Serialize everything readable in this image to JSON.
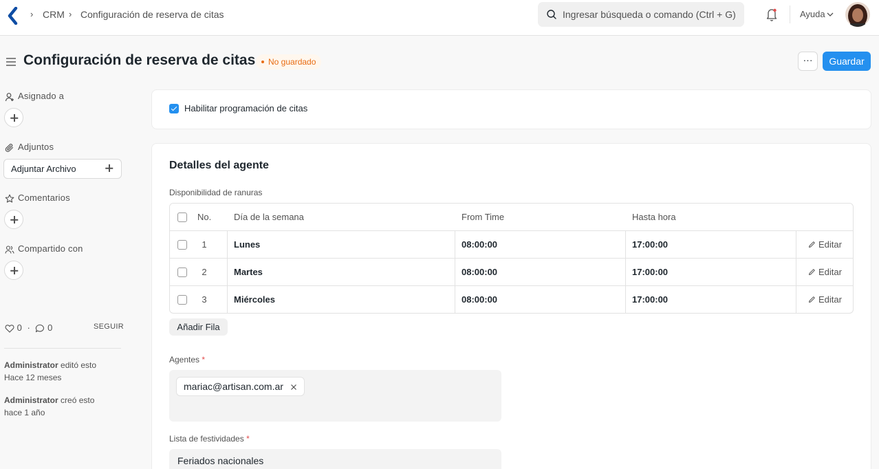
{
  "navbar": {
    "breadcrumbs": [
      "CRM",
      "Configuración de reserva de citas"
    ],
    "search_placeholder": "Ingresar búsqueda o comando (Ctrl + G)",
    "help_label": "Ayuda"
  },
  "header": {
    "title": "Configuración de reserva de citas",
    "status": "No guardado",
    "more_label": "···",
    "save_label": "Guardar"
  },
  "sidebar": {
    "assigned_label": "Asignado a",
    "attachments_label": "Adjuntos",
    "attach_button": "Adjuntar Archivo",
    "comments_label": "Comentarios",
    "shared_label": "Compartido con",
    "likes": "0",
    "comments_count": "0",
    "follow_label": "SEGUIR",
    "activity": [
      {
        "user": "Administrator",
        "action": " editó esto",
        "time": "Hace 12 meses"
      },
      {
        "user": "Administrator",
        "action": " creó esto",
        "time": "hace 1 año"
      }
    ]
  },
  "form": {
    "enable_label": "Habilitar programación de citas",
    "enable_checked": true,
    "section_title": "Detalles del agente",
    "slots_label": "Disponibilidad de ranuras",
    "table": {
      "headers": [
        "No.",
        "Día de la semana",
        "From Time",
        "Hasta hora"
      ],
      "rows": [
        {
          "no": "1",
          "day": "Lunes",
          "from": "08:00:00",
          "to": "17:00:00",
          "edit": "Editar"
        },
        {
          "no": "2",
          "day": "Martes",
          "from": "08:00:00",
          "to": "17:00:00",
          "edit": "Editar"
        },
        {
          "no": "3",
          "day": "Miércoles",
          "from": "08:00:00",
          "to": "17:00:00",
          "edit": "Editar"
        }
      ]
    },
    "add_row_label": "Añadir Fila",
    "agents_label": "Agentes",
    "agents": [
      "mariac@artisan.com.ar"
    ],
    "holiday_label": "Lista de festividades",
    "holiday_value": "Feriados nacionales",
    "required_mark": "*"
  },
  "colors": {
    "primary": "#2490ef",
    "status_warning": "#e86c13",
    "required": "#e24c4c"
  }
}
